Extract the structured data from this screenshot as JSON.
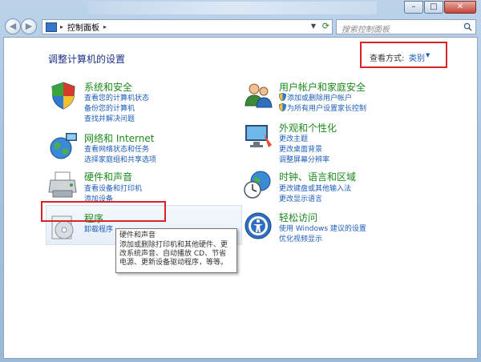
{
  "window": {
    "minimize_glyph": "–",
    "maximize_glyph": "□",
    "close_glyph": "✕"
  },
  "toolbar": {
    "back_glyph": "◀",
    "forward_glyph": "▶",
    "address_separator": "▸",
    "breadcrumb": "控制面板",
    "search_placeholder": "搜索控制面板"
  },
  "header": {
    "title": "调整计算机的设置",
    "view_by_label": "查看方式:",
    "view_by_value": "类别"
  },
  "categories": {
    "system_security": {
      "title": "系统和安全",
      "links": [
        "查看您的计算机状态",
        "备份您的计算机",
        "查找并解决问题"
      ]
    },
    "network_internet": {
      "title": "网络和 Internet",
      "links": [
        "查看网络状态和任务",
        "选择家庭组和共享选项"
      ]
    },
    "hardware_sound": {
      "title": "硬件和声音",
      "links": [
        "查看设备和打印机",
        "添加设备"
      ]
    },
    "programs": {
      "title": "程序",
      "links": [
        "卸载程序"
      ]
    },
    "user_accounts": {
      "title": "用户帐户和家庭安全",
      "links": [
        "添加或删除用户帐户",
        "为所有用户设置家长控制"
      ]
    },
    "appearance": {
      "title": "外观和个性化",
      "links": [
        "更改主题",
        "更改桌面背景",
        "调整屏幕分辨率"
      ]
    },
    "clock_region": {
      "title": "时钟、语言和区域",
      "links": [
        "更改键盘或其他输入法",
        "更改显示语言"
      ]
    },
    "ease_access": {
      "title": "轻松访问",
      "links": [
        "使用 Windows 建议的设置",
        "优化视频显示"
      ]
    }
  },
  "tooltip": {
    "title": "硬件和声音",
    "body": "添加或删除打印机和其他硬件、更改系统声音、自动播放 CD、节省电源、更新设备驱动程序，等等。"
  },
  "colors": {
    "accent_red": "#d9252a",
    "link_blue": "#1c5dbd",
    "category_green": "#1c8a1c",
    "title_blue": "#1e3287"
  }
}
